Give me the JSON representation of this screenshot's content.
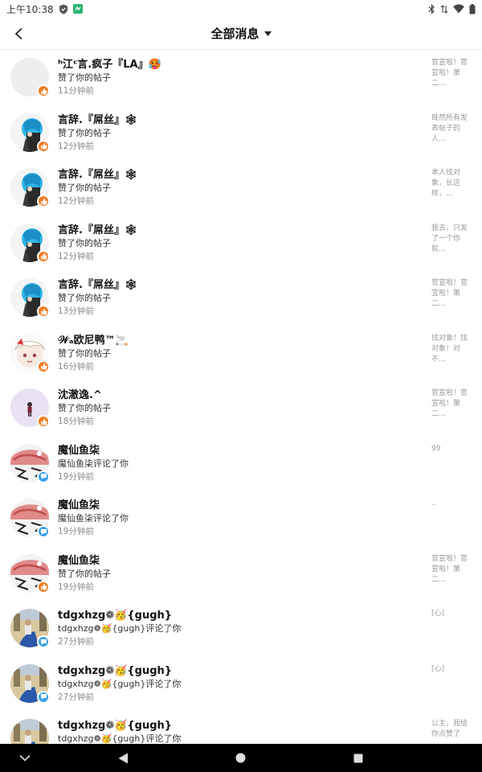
{
  "status_bar": {
    "time": "上午10:38"
  },
  "header": {
    "title": "全部消息"
  },
  "messages": [
    {
      "name": "ʰ江ᶜ言.疯子『LA』🥵",
      "action": "赞了你的帖子",
      "time": "11分钟前",
      "preview": "官宣啦！官宣啦！第二…",
      "badge": "like",
      "avatar": "blank"
    },
    {
      "name": "言辞.『屌丝』🕸",
      "action": "赞了你的帖子",
      "time": "12分钟前",
      "preview": "既然所有发表帖子的人…",
      "badge": "like",
      "avatar": "cyan"
    },
    {
      "name": "言辞.『屌丝』🕸",
      "action": "赞了你的帖子",
      "time": "12分钟前",
      "preview": "本人找对象，长这样，…",
      "badge": "like",
      "avatar": "cyan"
    },
    {
      "name": "言辞.『屌丝』🕸",
      "action": "赞了你的帖子",
      "time": "12分钟前",
      "preview": "我去，只发了一个你就…",
      "badge": "like",
      "avatar": "cyan"
    },
    {
      "name": "言辞.『屌丝』🕸",
      "action": "赞了你的帖子",
      "time": "13分钟前",
      "preview": "官宣啦！官宣啦！第二…",
      "badge": "like",
      "avatar": "cyan"
    },
    {
      "name": "𝒲ₐ欧尼鸭™🚬",
      "action": "赞了你的帖子",
      "time": "16分钟前",
      "preview": "找对象！找对象！对不…",
      "badge": "like",
      "avatar": "anime"
    },
    {
      "name": "沈澈逸.^",
      "action": "赞了你的帖子",
      "time": "18分钟前",
      "preview": "官宣啦！官宣啦！第二…",
      "badge": "like",
      "avatar": "lavender"
    },
    {
      "name": "魔仙鱼柒",
      "action": "魔仙鱼柒评论了你",
      "time": "19分钟前",
      "preview": "99",
      "badge": "comment",
      "avatar": "red"
    },
    {
      "name": "魔仙鱼柒",
      "action": "魔仙鱼柒评论了你",
      "time": "19分钟前",
      "preview": "..",
      "badge": "comment",
      "avatar": "red"
    },
    {
      "name": "魔仙鱼柒",
      "action": "赞了你的帖子",
      "time": "19分钟前",
      "preview": "官宣啦！官宣啦！第二…",
      "badge": "like",
      "avatar": "red"
    },
    {
      "name": "tdgxhzg❁🥳{gugh}",
      "action": "tdgxhzg❁🥳{gugh}评论了你",
      "time": "27分钟前",
      "preview": "[心]",
      "badge": "comment",
      "avatar": "street"
    },
    {
      "name": "tdgxhzg❁🥳{gugh}",
      "action": "tdgxhzg❁🥳{gugh}评论了你",
      "time": "27分钟前",
      "preview": "[心]",
      "badge": "comment",
      "avatar": "street"
    },
    {
      "name": "tdgxhzg❁🥳{gugh}",
      "action": "tdgxhzg❁🥳{gugh}评论了你",
      "time": "",
      "preview": "公主，我给你点赞了",
      "badge": "comment",
      "avatar": "street"
    }
  ],
  "colors": {
    "like_badge": "#f07a20",
    "comment_badge": "#3aa0e8",
    "nav_bar": "#000000"
  },
  "icons": {
    "status": [
      "shield-icon",
      "app-icon",
      "bluetooth-icon",
      "data-arrows-icon",
      "wifi-icon",
      "battery-icon"
    ],
    "nav": [
      "keyboard-hide-icon",
      "back-triangle-icon",
      "home-circle-icon",
      "recents-square-icon"
    ]
  }
}
